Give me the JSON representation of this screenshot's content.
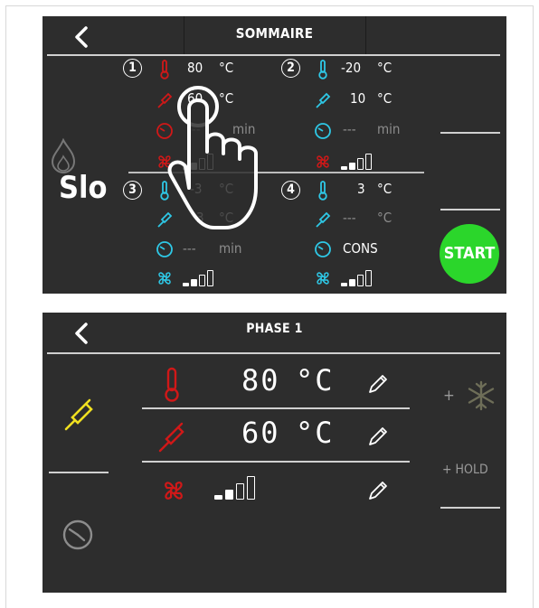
{
  "colors": {
    "screen_bg": "#2d2d2d",
    "red": "#d01818",
    "cyan": "#2ec8e6",
    "yellow": "#f0e020",
    "green": "#2bd62b",
    "gray": "#8c8c8c"
  },
  "summary": {
    "title": "SOMMAIRE",
    "zones": [
      {
        "number": "1",
        "temp_value": "80",
        "temp_unit": "°C",
        "probe_value": "60",
        "probe_unit": "°C",
        "time_value": "---",
        "time_unit": "min",
        "fan_level": 2,
        "theme": "hot"
      },
      {
        "number": "2",
        "temp_value": "-20",
        "temp_unit": "°C",
        "probe_value": "10",
        "probe_unit": "°C",
        "time_value": "---",
        "time_unit": "min",
        "fan_level": 2,
        "theme": "cold"
      },
      {
        "number": "3",
        "temp_value": "-3",
        "temp_unit": "°C",
        "probe_value": "3",
        "probe_unit": "°C",
        "time_value": "---",
        "time_unit": "min",
        "fan_level": 2,
        "theme": "cold"
      },
      {
        "number": "4",
        "temp_value": "3",
        "temp_unit": "°C",
        "probe_value": "---",
        "probe_unit": "°C",
        "time_value": "CONS",
        "time_unit": "",
        "fan_level": 2,
        "theme": "cold"
      }
    ],
    "mode_label": "Slo",
    "start_label": "START"
  },
  "phase": {
    "title": "PHASE 1",
    "temp_value": "80",
    "temp_unit": "°C",
    "probe_value": "60",
    "probe_unit": "°C",
    "fan_level": 2,
    "option_freeze": "+",
    "option_hold": "+ HOLD"
  }
}
